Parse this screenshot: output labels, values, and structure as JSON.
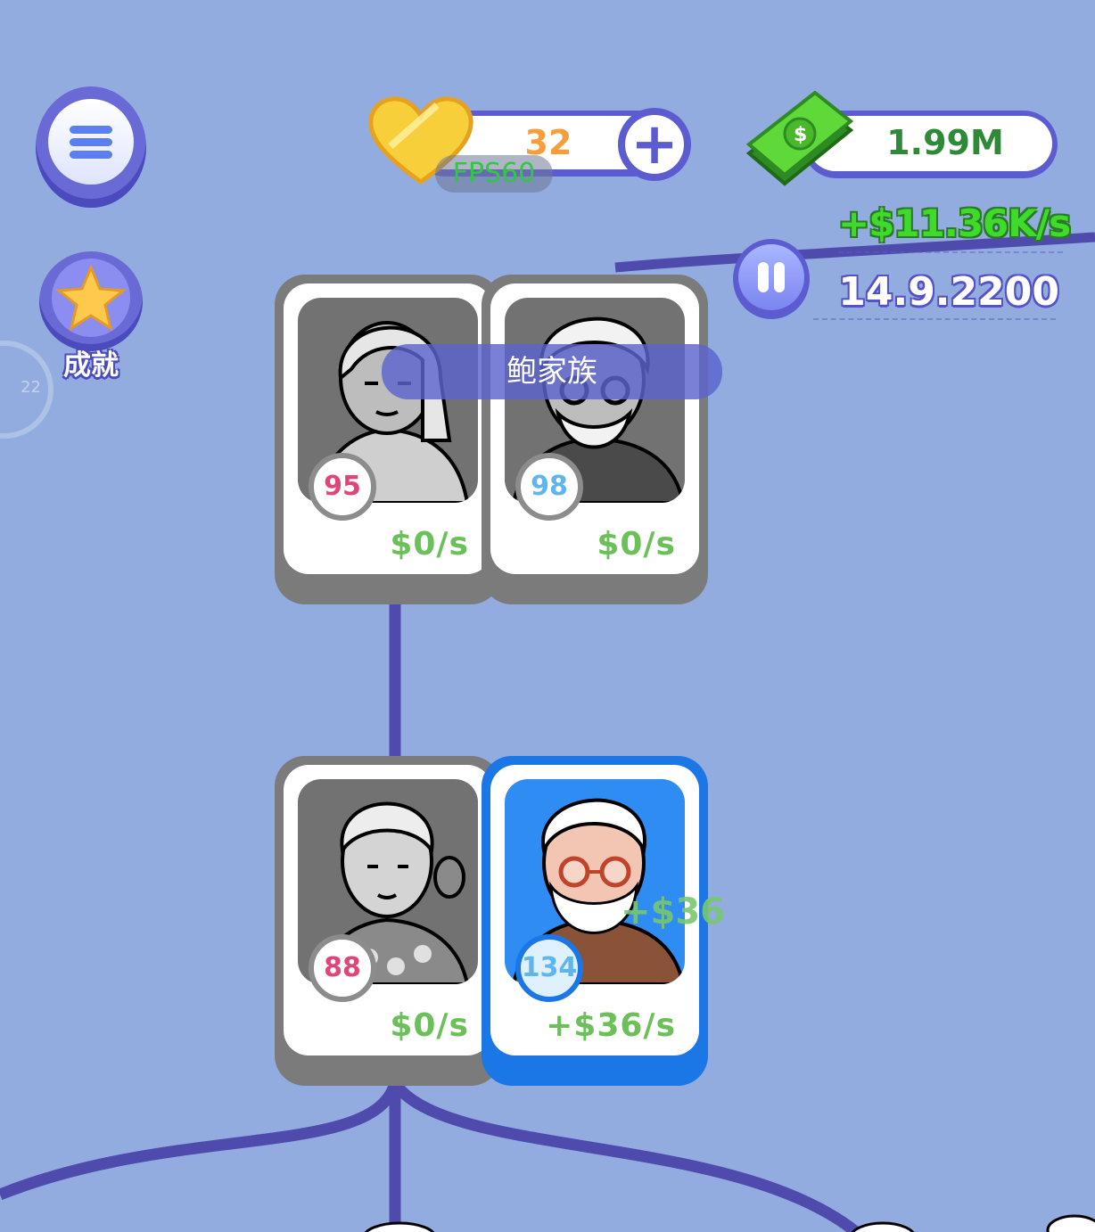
{
  "menu": {
    "icon": "hamburger-menu-icon"
  },
  "achievements": {
    "label": "成就",
    "icon": "star-icon"
  },
  "side_badge": {
    "text": "22"
  },
  "hearts": {
    "icon": "heart-icon",
    "value": "32",
    "add_icon": "plus-icon"
  },
  "fps": {
    "text": "FPS60"
  },
  "money": {
    "icon": "cash-stack-icon",
    "value": "1.99M"
  },
  "income": {
    "rate": "+$11.36K/s"
  },
  "game_date": {
    "value": "14.9.2200",
    "pause_icon": "pause-icon"
  },
  "family": {
    "name": "鲍家族"
  },
  "cards": [
    {
      "level": "95",
      "rate": "$0/s",
      "state": "inactive",
      "level_color": "#e0457a"
    },
    {
      "level": "98",
      "rate": "$0/s",
      "state": "inactive",
      "level_color": "#5fb6ee"
    },
    {
      "level": "88",
      "rate": "$0/s",
      "state": "inactive",
      "level_color": "#e0457a"
    },
    {
      "level": "134",
      "rate": "+$36/s",
      "state": "active",
      "level_color": "#5fb6ee"
    }
  ],
  "floating_gain": "+$36",
  "colors": {
    "background": "#93acdf",
    "accent": "#5c5cd0",
    "active_card": "#1b76e6",
    "money_green": "#3edb2a"
  }
}
